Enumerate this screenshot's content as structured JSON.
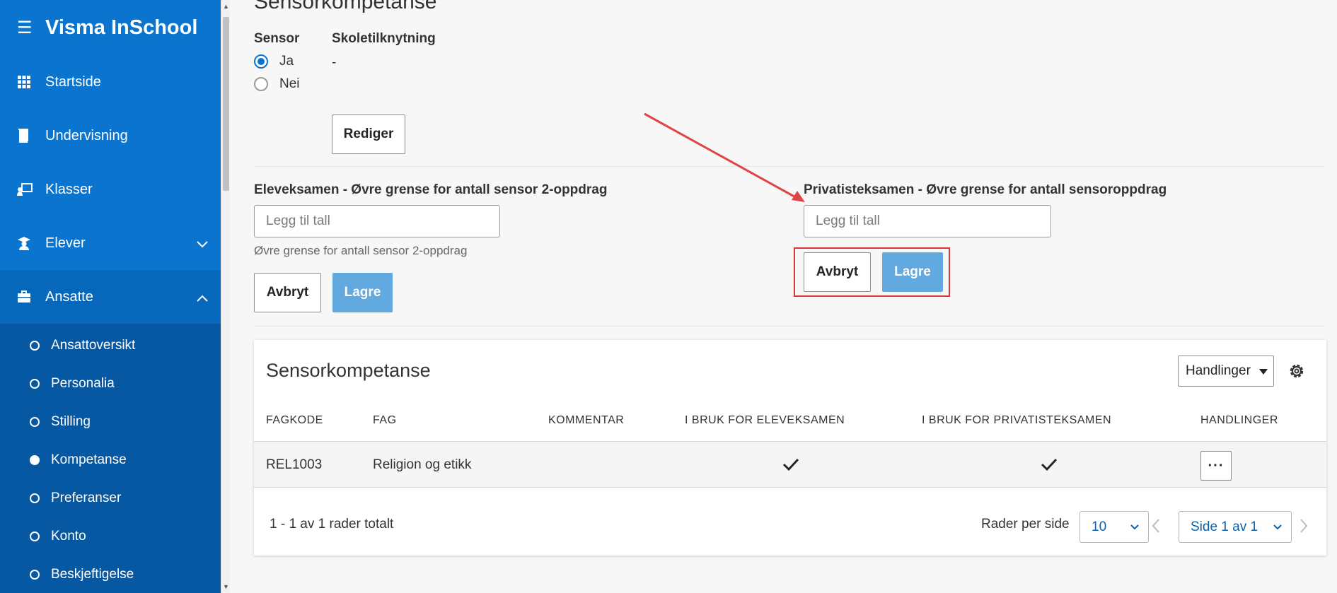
{
  "app": {
    "title": "Visma InSchool"
  },
  "sidebar": {
    "items": [
      {
        "label": "Startside",
        "icon": "grid-icon"
      },
      {
        "label": "Undervisning",
        "icon": "book-icon"
      },
      {
        "label": "Klasser",
        "icon": "classroom-icon"
      },
      {
        "label": "Elever",
        "icon": "student-icon"
      },
      {
        "label": "Ansatte",
        "icon": "briefcase-icon"
      }
    ],
    "sub_items": [
      {
        "label": "Ansattoversikt"
      },
      {
        "label": "Personalia"
      },
      {
        "label": "Stilling"
      },
      {
        "label": "Kompetanse"
      },
      {
        "label": "Preferanser"
      },
      {
        "label": "Konto"
      },
      {
        "label": "Beskjeftigelse"
      }
    ]
  },
  "section": {
    "heading": "Sensorkompetanse",
    "sensor_label": "Sensor",
    "radio_ja": "Ja",
    "radio_nei": "Nei",
    "skole_label": "Skoletilknytning",
    "skole_value": "-",
    "rediger_label": "Rediger"
  },
  "elev": {
    "label": "Eleveksamen - Øvre grense for antall sensor 2-oppdrag",
    "placeholder": "Legg til tall",
    "helper": "Øvre grense for antall sensor 2-oppdrag",
    "cancel_label": "Avbryt",
    "save_label": "Lagre"
  },
  "privat": {
    "label": "Privatisteksamen - Øvre grense for antall sensoroppdrag",
    "placeholder": "Legg til tall",
    "cancel_label": "Avbryt",
    "save_label": "Lagre"
  },
  "table": {
    "title": "Sensorkompetanse",
    "actions_label": "Handlinger",
    "columns": [
      "FAGKODE",
      "FAG",
      "KOMMENTAR",
      "I BRUK FOR ELEVEKSAMEN",
      "I BRUK FOR PRIVATISTEKSAMEN",
      "HANDLINGER"
    ],
    "rows": [
      {
        "fagkode": "REL1003",
        "fag": "Religion og etikk",
        "kommentar": "",
        "elev": true,
        "privat": true,
        "more": "···"
      }
    ],
    "footer_count": "1 - 1 av 1 rader totalt",
    "rows_per_page_label": "Rader per side",
    "rows_per_page": "10",
    "page_label": "Side 1 av 1"
  },
  "colors": {
    "sidebar": "#0a74cf",
    "subnav": "#0658a3",
    "primary_button": "#62a9e0",
    "highlight": "#d9383a",
    "annotation_arrow": "#e04444"
  }
}
